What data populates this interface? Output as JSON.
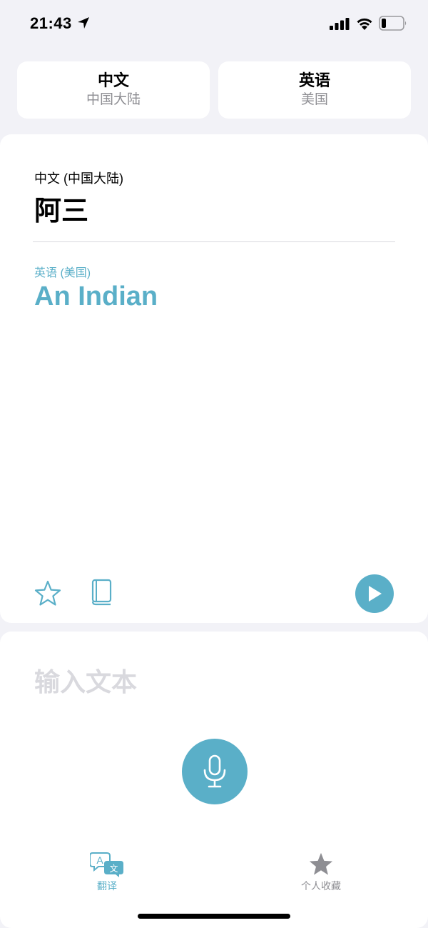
{
  "status_bar": {
    "time": "21:43"
  },
  "language_selector": {
    "source": {
      "name": "中文",
      "region": "中国大陆"
    },
    "target": {
      "name": "英语",
      "region": "美国"
    }
  },
  "translation": {
    "source_label": "中文 (中国大陆)",
    "source_text": "阿三",
    "target_label": "英语 (美国)",
    "target_text": "An Indian"
  },
  "input": {
    "placeholder": "输入文本"
  },
  "tab_bar": {
    "translate_label": "翻译",
    "favorites_label": "个人收藏"
  },
  "colors": {
    "accent": "#5aafc8",
    "background": "#f2f2f7",
    "card": "#ffffff",
    "secondary_text": "#8e8e93"
  },
  "icons": [
    "location-arrow-icon",
    "signal-icon",
    "wifi-icon",
    "battery-icon",
    "star-icon",
    "dictionary-icon",
    "play-icon",
    "microphone-icon",
    "translate-tab-icon",
    "favorites-star-icon"
  ]
}
